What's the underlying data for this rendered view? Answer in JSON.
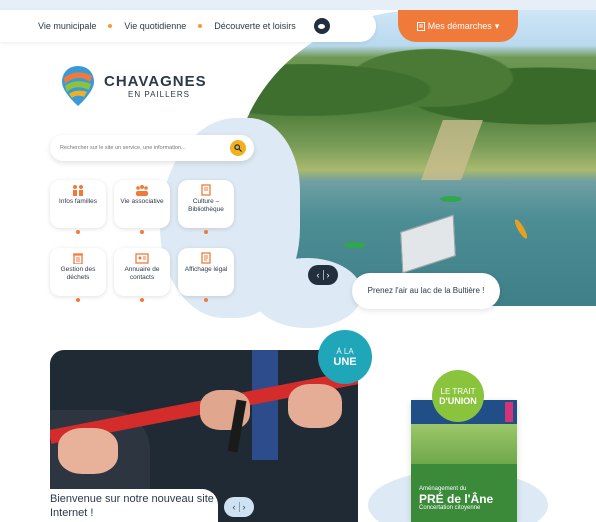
{
  "nav": {
    "items": [
      "Vie municipale",
      "Vie quotidienne",
      "Découverte et loisirs"
    ],
    "demarches_label": "Mes démarches",
    "demarches_caret": "▾"
  },
  "logo": {
    "title": "CHAVAGNES",
    "subtitle": "EN PAILLERS"
  },
  "search": {
    "placeholder": "Rechercher sur le site un service, une information..."
  },
  "tiles": [
    {
      "label": "Infos familles",
      "icon": "family-icon"
    },
    {
      "label": "Vie associative",
      "icon": "people-icon"
    },
    {
      "label": "Culture – Bibliothèque",
      "icon": "book-icon"
    },
    {
      "label": "Gestion des déchets",
      "icon": "trash-icon"
    },
    {
      "label": "Annuaire de contacts",
      "icon": "contacts-icon"
    },
    {
      "label": "Affichage légal",
      "icon": "document-icon"
    }
  ],
  "hero": {
    "caption": "Prenez l'air au lac de la Bultière !",
    "prev": "‹",
    "next": "›"
  },
  "news": {
    "badge_small": "À LA",
    "badge_big": "UNE",
    "title": "Bienvenue sur notre nouveau site Internet !",
    "prev": "‹",
    "next": "›"
  },
  "magazine": {
    "badge_small": "LE TRAIT",
    "badge_big": "D'UNION",
    "cover_kicker": "Aménagement du",
    "cover_title": "PRÉ de l'Âne",
    "cover_sub": "Concertation citoyenne"
  },
  "colors": {
    "accent": "#f07a3a",
    "une": "#1fa6b8",
    "trait": "#8ac33c",
    "dark": "#22303e"
  }
}
